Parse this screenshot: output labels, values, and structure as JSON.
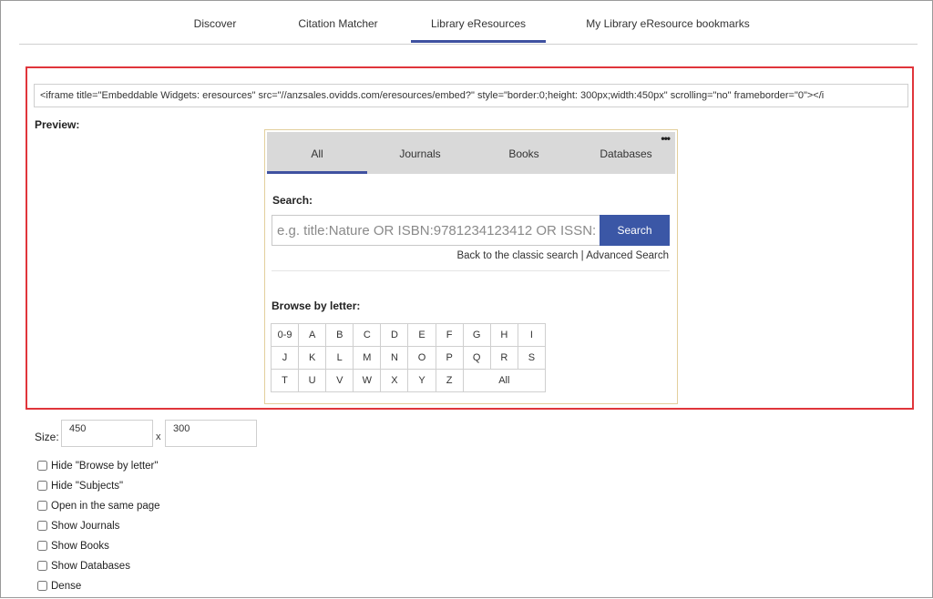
{
  "nav": {
    "tabs": [
      {
        "label": "Discover"
      },
      {
        "label": "Citation Matcher"
      },
      {
        "label": "Library eResources",
        "active": true
      },
      {
        "label": "My Library eResource bookmarks"
      }
    ]
  },
  "embed": {
    "code": "<iframe title=\"Embeddable Widgets: eresources\" src=\"//anzsales.ovidds.com/eresources/embed?\" style=\"border:0;height: 300px;width:450px\" scrolling=\"no\" frameborder=\"0\"></i"
  },
  "preview": {
    "label": "Preview:"
  },
  "widget": {
    "tabs": [
      "All",
      "Journals",
      "Books",
      "Databases"
    ],
    "search_label": "Search:",
    "search_placeholder": "e.g. title:Nature OR ISBN:9781234123412 OR ISSN:",
    "search_button": "Search",
    "classic_link": "Back to the classic search",
    "separator": "|",
    "advanced_link": "Advanced Search",
    "browse_label": "Browse by letter:",
    "letter_rows": [
      [
        "0-9",
        "A",
        "B",
        "C",
        "D",
        "E",
        "F",
        "G",
        "H",
        "I"
      ],
      [
        "J",
        "K",
        "L",
        "M",
        "N",
        "O",
        "P",
        "Q",
        "R",
        "S"
      ],
      [
        "T",
        "U",
        "V",
        "W",
        "X",
        "Y",
        "Z",
        "All"
      ]
    ]
  },
  "settings": {
    "size_label": "Size:",
    "width": "450",
    "x_label": "x",
    "height": "300",
    "options": [
      "Hide \"Browse by letter\"",
      "Hide \"Subjects\"",
      "Open in the same page",
      "Show Journals",
      "Show Books",
      "Show Databases",
      "Dense"
    ]
  },
  "colors": {
    "accent": "#3f51a0",
    "search_button": "#3b57a6",
    "highlight": "#e0353b"
  }
}
